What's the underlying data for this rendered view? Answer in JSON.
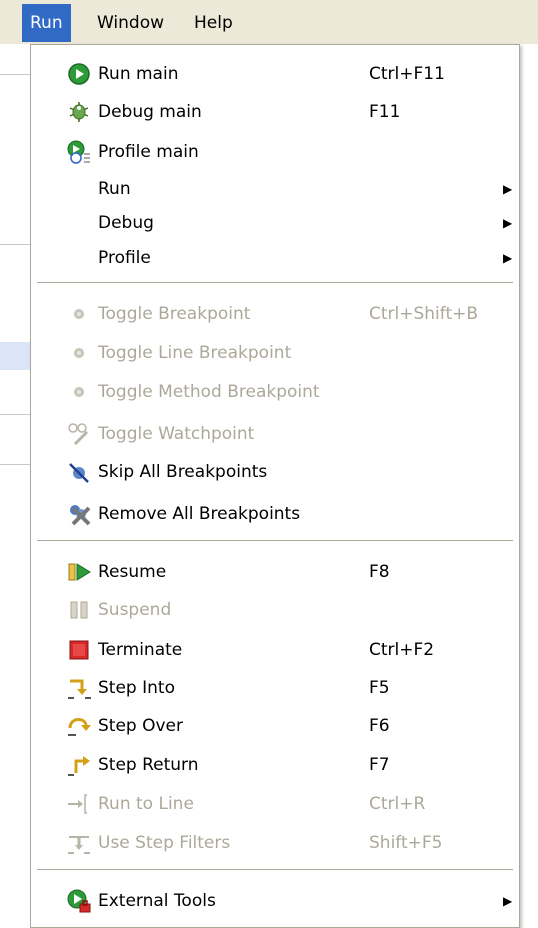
{
  "menubar": {
    "items": [
      "Run",
      "Window",
      "Help"
    ]
  },
  "menu": {
    "items": [
      {
        "label": "Run main",
        "accel": "Ctrl+F11",
        "icon": "run-icon",
        "enabled": true
      },
      {
        "label": "Debug main",
        "accel": "F11",
        "icon": "debug-bug-icon",
        "enabled": true
      },
      {
        "label": "Profile main",
        "accel": "",
        "icon": "profile-icon",
        "enabled": true
      },
      {
        "label": "Run",
        "accel": "",
        "submenu": true,
        "enabled": true
      },
      {
        "label": "Debug",
        "accel": "",
        "submenu": true,
        "enabled": true
      },
      {
        "label": "Profile",
        "accel": "",
        "submenu": true,
        "enabled": true
      },
      {
        "label": "Toggle Breakpoint",
        "accel": "Ctrl+Shift+B",
        "icon": "breakpoint-dot-icon",
        "enabled": false
      },
      {
        "label": "Toggle Line Breakpoint",
        "accel": "",
        "icon": "breakpoint-dot-icon",
        "enabled": false
      },
      {
        "label": "Toggle Method Breakpoint",
        "accel": "",
        "icon": "breakpoint-dot-icon",
        "enabled": false
      },
      {
        "label": "Toggle Watchpoint",
        "accel": "",
        "icon": "watchpoint-glasses-icon",
        "enabled": false
      },
      {
        "label": "Skip All Breakpoints",
        "accel": "",
        "icon": "skip-breakpoints-icon",
        "enabled": true
      },
      {
        "label": "Remove All Breakpoints",
        "accel": "",
        "icon": "remove-breakpoints-icon",
        "enabled": true
      },
      {
        "label": "Resume",
        "accel": "F8",
        "icon": "resume-icon",
        "enabled": true
      },
      {
        "label": "Suspend",
        "accel": "",
        "icon": "suspend-icon",
        "enabled": false
      },
      {
        "label": "Terminate",
        "accel": "Ctrl+F2",
        "icon": "terminate-icon",
        "enabled": true
      },
      {
        "label": "Step Into",
        "accel": "F5",
        "icon": "step-into-icon",
        "enabled": true
      },
      {
        "label": "Step Over",
        "accel": "F6",
        "icon": "step-over-icon",
        "enabled": true
      },
      {
        "label": "Step Return",
        "accel": "F7",
        "icon": "step-return-icon",
        "enabled": true
      },
      {
        "label": "Run to Line",
        "accel": "Ctrl+R",
        "icon": "run-to-line-icon",
        "enabled": false
      },
      {
        "label": "Use Step Filters",
        "accel": "Shift+F5",
        "icon": "step-filters-icon",
        "enabled": false
      },
      {
        "label": "External Tools",
        "accel": "",
        "icon": "external-tools-icon",
        "submenu": true,
        "enabled": true
      }
    ]
  },
  "colors": {
    "highlight": "#316ac5",
    "disabled_text": "#aca899"
  }
}
